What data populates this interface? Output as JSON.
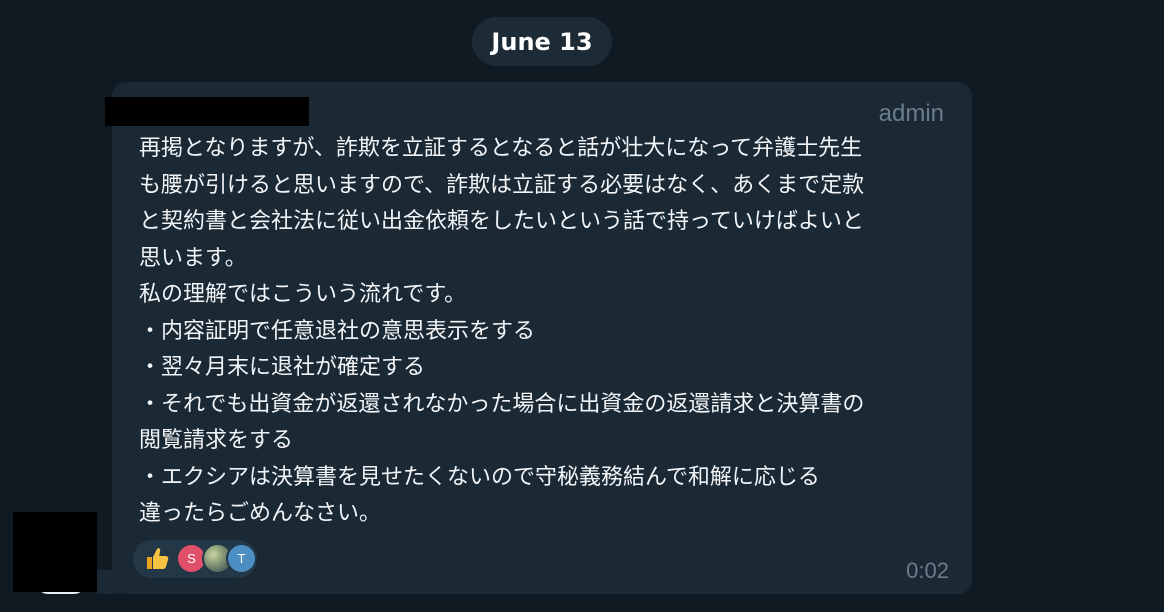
{
  "date_separator": "June 13",
  "message": {
    "role_label": "admin",
    "lines": [
      "再掲となりますが、詐欺を立証するとなると話が壮大になって弁護士先生",
      "も腰が引けると思いますので、詐欺は立証する必要はなく、あくまで定款",
      "と契約書と会社法に従い出金依頼をしたいという話で持っていけばよいと",
      "思います。",
      "私の理解ではこういう流れです。",
      "・内容証明で任意退社の意思表示をする",
      "・翌々月末に退社が確定する",
      "・それでも出資金が返還されなかった場合に出資金の返還請求と決算書の",
      "閲覧請求をする",
      "・エクシアは決算書を見せたくないので守秘義務結んで和解に応じる",
      "違ったらごめんなさい。"
    ],
    "time": "0:02",
    "reactions": {
      "emoji_icon": "thumbs-up-icon",
      "reactors": [
        "S",
        "",
        "T"
      ]
    }
  },
  "colors": {
    "background": "#101a23",
    "bubble": "#1b2935",
    "date_pill": "#1d2b37",
    "muted_text": "#6b7d8c",
    "reactor_s": "#e24f68",
    "reactor_t": "#4b8ec3"
  }
}
